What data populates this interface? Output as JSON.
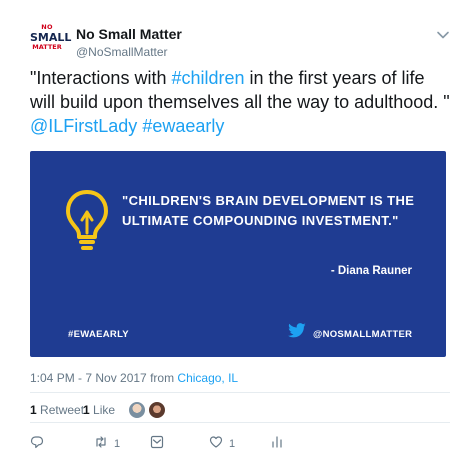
{
  "account": {
    "logo_lines": [
      "NO",
      "SMALL",
      "MATTER"
    ],
    "display_name": "No Small Matter",
    "handle": "@NoSmallMatter"
  },
  "tweet": {
    "text_1": "\"Interactions with ",
    "hashtag_children": "#children",
    "text_2": " in the first years of life will build upon themselves all the way to adulthood. \" ",
    "mention": "@ILFirstLady",
    "hashtag_ewaearly": "#ewaearly"
  },
  "media": {
    "quote": "\"CHILDREN'S BRAIN DEVELOPMENT IS THE ULTIMATE COMPOUNDING INVESTMENT.\"",
    "attribution": "- Diana Rauner",
    "hashtag": "#EWAEARLY",
    "brand_handle": "@NOSMALLMATTER",
    "background_color": "#1f3c92",
    "bulb_color": "#f5c518",
    "icon": "lightbulb-icon",
    "bird_icon": "twitter-bird-icon"
  },
  "meta": {
    "time": "1:04 PM - 7 Nov 2017 from ",
    "location": "Chicago, IL"
  },
  "stats": {
    "retweet_count": "1",
    "retweet_label": "Retweet",
    "like_count": "1",
    "like_label": "Like"
  },
  "actions": {
    "reply_icon": "reply-icon",
    "retweet_icon": "retweet-icon",
    "retweet_count": "1",
    "dm_icon": "dm-icon",
    "like_icon": "heart-icon",
    "like_count": "1",
    "analytics_icon": "analytics-icon"
  },
  "colors": {
    "link": "#1da1f2",
    "secondary_text": "#657786",
    "primary_text": "#14171a"
  }
}
